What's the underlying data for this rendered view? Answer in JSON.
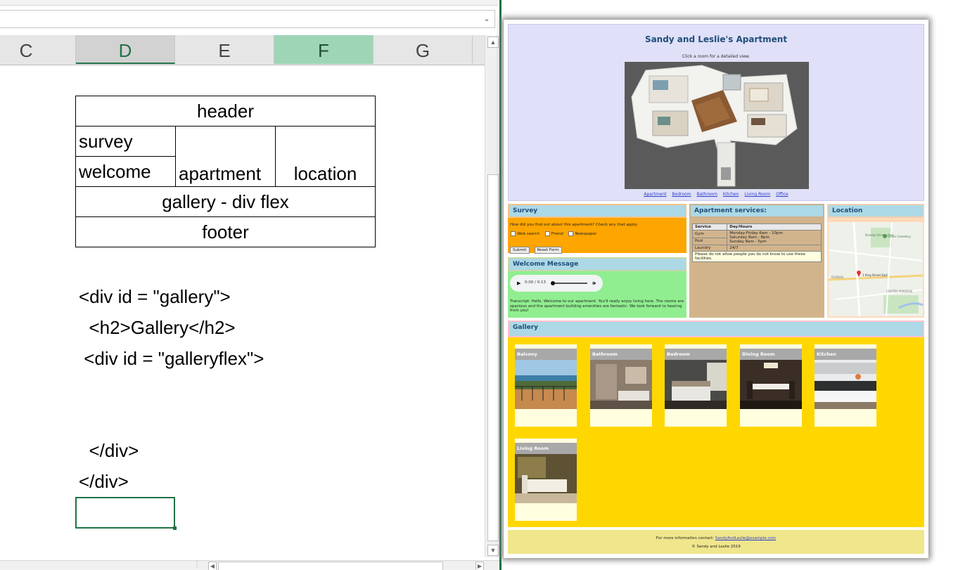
{
  "excel": {
    "columns": [
      {
        "label": "C"
      },
      {
        "label": "D"
      },
      {
        "label": "E"
      },
      {
        "label": "F"
      },
      {
        "label": "G"
      }
    ],
    "layout_table": {
      "header": "header",
      "survey": "survey",
      "welcome": "welcome",
      "apartment": "apartment",
      "location": "location",
      "gallery": "gallery - div flex",
      "footer": "footer"
    },
    "code_lines": [
      "<div id = \"gallery\">",
      "  <h2>Gallery</h2>",
      " <div id = \"galleryflex\">",
      "  </div>",
      "</div>"
    ]
  },
  "preview": {
    "title": "Sandy and Leslie's Apartment",
    "instruction": "Click a room for a detailed view.",
    "nav": [
      "Apartment",
      "Bedroom",
      "Bathroom",
      "Kitchen",
      "Living Room",
      "Office"
    ],
    "survey": {
      "heading": "Survey",
      "question": "How did you find out about this apartment? Check any that apply:",
      "options": [
        "Web search",
        "Friend",
        "Newspaper"
      ],
      "submit": "Submit",
      "reset": "Reset Form"
    },
    "welcome": {
      "heading": "Welcome Message",
      "time": "0:00 / 0:13",
      "transcript": "Transcript: Hello. Welcome to our apartment. You'll really enjoy living here. The rooms are spacious and the apartment building amenities are fantastic. We look forward to hearing from you!"
    },
    "services": {
      "heading": "Apartment services:",
      "col_service": "Service",
      "col_hours": "Day/Hours",
      "rows": [
        {
          "service": "Gym",
          "hours1": "Monday-Friday 6am - 10pm",
          "hours2": "Saturday 8am - 8pm"
        },
        {
          "service": "Pool",
          "hours1": "Sunday 8am - 5pm",
          "hours2": ""
        },
        {
          "service": "Laundry",
          "hours1": "24/7",
          "hours2": ""
        }
      ],
      "note": "Please do not allow people you do not know to use these facilities."
    },
    "location": {
      "heading": "Location",
      "map_labels": [
        "Dundas Driving Park",
        "Grove Cemetery",
        "1 King Street East",
        "DUNDAS",
        "COOTES PARADISE"
      ]
    },
    "gallery": {
      "heading": "Gallery",
      "items": [
        "Balcony",
        "Bathroom",
        "Bedroom",
        "Dining Room",
        "Kitchen",
        "Living Room"
      ]
    },
    "footer": {
      "contact_prefix": "For more information contact: ",
      "email": "SandyAndLeslie@example.com",
      "copyright": "© Sandy and Leslie 2019"
    }
  }
}
